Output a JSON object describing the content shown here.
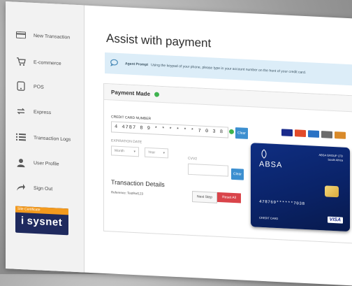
{
  "sidebar": {
    "items": [
      {
        "label": "New Transaction",
        "icon": "card-icon"
      },
      {
        "label": "E-commerce",
        "icon": "cart-icon"
      },
      {
        "label": "POS",
        "icon": "phone-icon"
      },
      {
        "label": "Express",
        "icon": "express-icon"
      },
      {
        "label": "Transaction Logs",
        "icon": "list-icon"
      },
      {
        "label": "User Profile",
        "icon": "user-icon"
      },
      {
        "label": "Sign Out",
        "icon": "signout-icon"
      }
    ],
    "brand": {
      "tagline": "Site Certificate",
      "name": "sysnet",
      "mark": "i"
    }
  },
  "main": {
    "title": "Assist with payment",
    "prompt": {
      "label": "Agent Prompt",
      "text": "Using the keypad of your phone, please type in your account number on the front of your credit card."
    },
    "panel": {
      "title": "Payment Made",
      "cc_label": "CREDIT CARD NUMBER",
      "cc_value": "4 4787 8 9 * * * * * * 7 0 3 8",
      "clear_label": "Clear",
      "expiry_label": "EXPIRATION DATE",
      "month_placeholder": "Month",
      "year_placeholder": "Year",
      "cvv_label": "CVV2",
      "cvv_clear_label": "Clear",
      "transaction_title": "Transaction Details",
      "reference": "Reference: TestRef123",
      "next_label": "Next Step",
      "reset_label": "Reset All"
    },
    "card": {
      "bank": "ABSA",
      "issuer_line1": "ABSA GROUP LTD",
      "issuer_line2": "South Africa",
      "number": "478769******7038",
      "type": "CREDIT CARD",
      "network": "VISA"
    },
    "logos": [
      {
        "name": "visa-logo",
        "color": "#1a2b8c"
      },
      {
        "name": "mastercard-logo",
        "color": "#e24b2a"
      },
      {
        "name": "amex-logo",
        "color": "#2a72c4"
      },
      {
        "name": "diners-logo",
        "color": "#6b6b6b"
      },
      {
        "name": "discover-logo",
        "color": "#d98a2a"
      }
    ]
  }
}
